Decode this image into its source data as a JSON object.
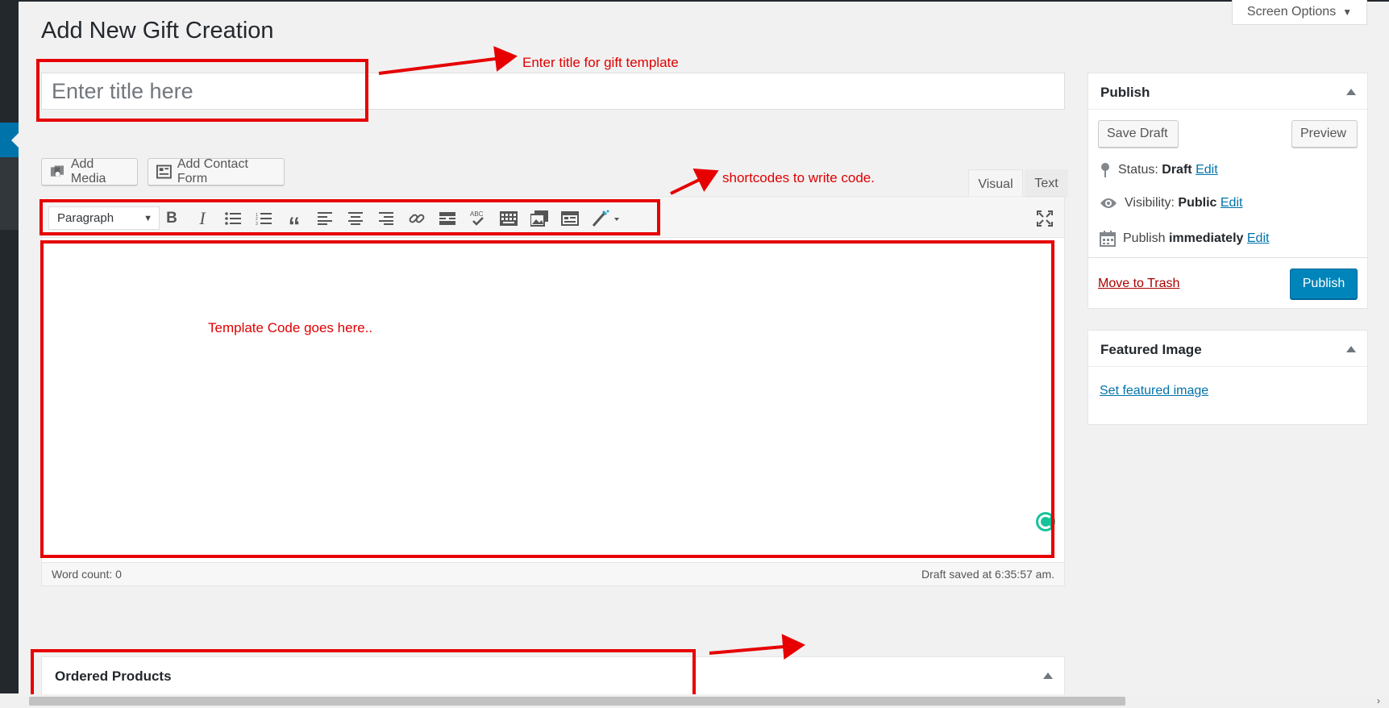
{
  "page": {
    "title": "Add New Gift Creation"
  },
  "screen_options": {
    "label": "Screen Options"
  },
  "title_field": {
    "placeholder": "Enter title here"
  },
  "media_buttons": {
    "add_media": "Add Media",
    "add_contact_form": "Add Contact Form"
  },
  "editor": {
    "tabs": {
      "visual": "Visual",
      "text": "Text"
    },
    "format_select": "Paragraph",
    "toolbar_icons": [
      "bold-icon",
      "italic-icon",
      "bullet-list-icon",
      "numbered-list-icon",
      "blockquote-icon",
      "align-left-icon",
      "align-center-icon",
      "align-right-icon",
      "link-icon",
      "read-more-icon",
      "spellcheck-icon",
      "keyboard-shortcuts-icon",
      "gallery-icon",
      "form-icon",
      "shortcode-wand-icon",
      "fullscreen-icon"
    ],
    "word_count": "Word count: 0",
    "draft_saved": "Draft saved at 6:35:57 am."
  },
  "publish_box": {
    "title": "Publish",
    "save_draft": "Save Draft",
    "preview": "Preview",
    "status_label": "Status:",
    "status_value": "Draft",
    "visibility_label": "Visibility:",
    "visibility_value": "Public",
    "publish_label": "Publish",
    "publish_value": "immediately",
    "edit": "Edit",
    "move_to_trash": "Move to Trash",
    "publish_button": "Publish"
  },
  "featured_image_box": {
    "title": "Featured Image",
    "set_link": "Set featured image"
  },
  "ordered_products_box": {
    "title": "Ordered Products"
  },
  "annotations": {
    "title_note": "Enter title for gift template",
    "shortcodes_note": "shortcodes to write code.",
    "template_note": "Template Code goes here.."
  },
  "colors": {
    "annotation_red": "#e60000",
    "primary_blue": "#0085ba",
    "link_blue": "#0073aa",
    "admin_dark": "#23282d"
  }
}
